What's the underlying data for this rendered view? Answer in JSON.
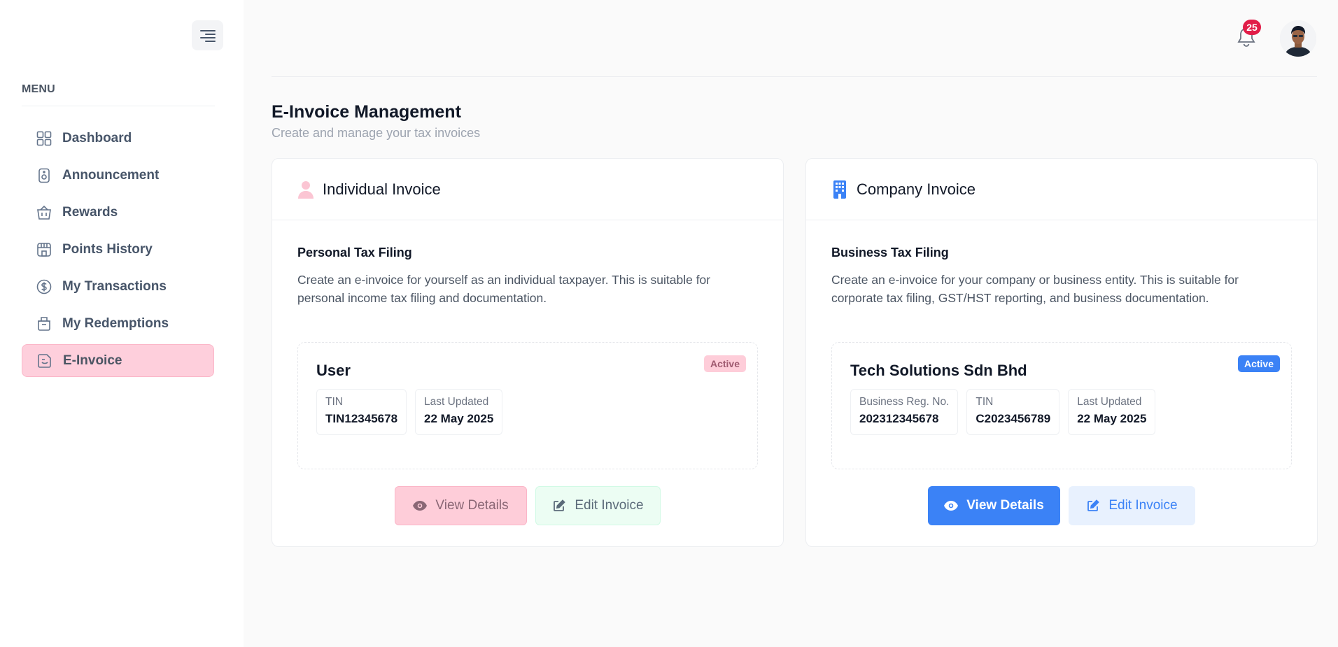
{
  "sidebar": {
    "menu_heading": "MENU",
    "items": [
      {
        "label": "Dashboard",
        "icon": "grid-icon"
      },
      {
        "label": "Announcement",
        "icon": "speaker-icon"
      },
      {
        "label": "Rewards",
        "icon": "basket-icon"
      },
      {
        "label": "Points History",
        "icon": "store-icon"
      },
      {
        "label": "My Transactions",
        "icon": "dollar-icon"
      },
      {
        "label": "My Redemptions",
        "icon": "package-icon"
      },
      {
        "label": "E-Invoice",
        "icon": "document-icon",
        "active": true
      }
    ]
  },
  "header": {
    "notification_count": "25"
  },
  "page": {
    "title": "E-Invoice Management",
    "subtitle": "Create and manage your tax invoices"
  },
  "individual": {
    "header_title": "Individual Invoice",
    "section_title": "Personal Tax Filing",
    "description": "Create an e-invoice for yourself as an individual taxpayer. This is suitable for personal income tax filing and documentation.",
    "entity_name": "User",
    "status": "Active",
    "fields": [
      {
        "label": "TIN",
        "value": "TIN12345678"
      },
      {
        "label": "Last Updated",
        "value": "22 May 2025"
      }
    ],
    "view_label": "View Details",
    "edit_label": "Edit Invoice"
  },
  "company": {
    "header_title": "Company Invoice",
    "section_title": "Business Tax Filing",
    "description": "Create an e-invoice for your company or business entity. This is suitable for corporate tax filing, GST/HST reporting, and business documentation.",
    "entity_name": "Tech Solutions Sdn Bhd",
    "status": "Active",
    "fields": [
      {
        "label": "Business Reg. No.",
        "value": "202312345678"
      },
      {
        "label": "TIN",
        "value": "C2023456789"
      },
      {
        "label": "Last Updated",
        "value": "22 May 2025"
      }
    ],
    "view_label": "View Details",
    "edit_label": "Edit Invoice"
  },
  "colors": {
    "accent_pink": "#fecfdc",
    "accent_blue": "#3b82f6",
    "badge_red": "#e11d48"
  }
}
